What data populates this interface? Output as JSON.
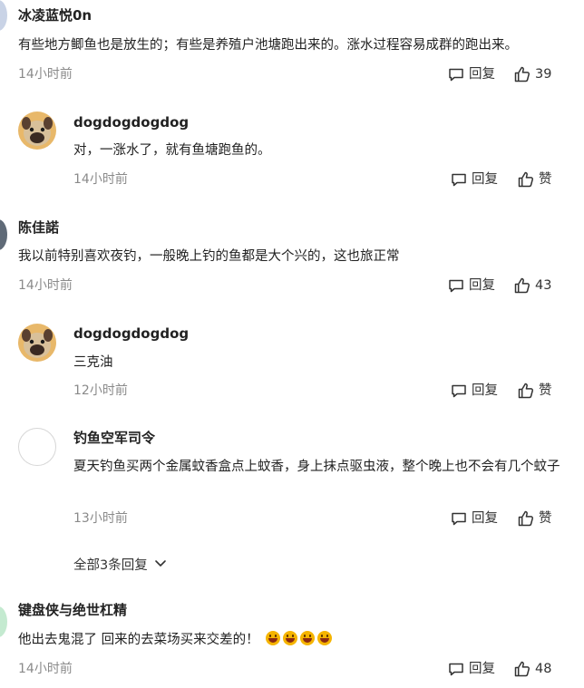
{
  "comments": [
    {
      "author": "冰凌蓝悦0n",
      "text": "有些地方鲫鱼也是放生的；有些是养殖户池塘跑出来的。涨水过程容易成群的跑出来。",
      "time": "14小时前",
      "reply_label": "回复",
      "likes": "39",
      "avatar_color": "#c9d3e6"
    },
    {
      "author": "dogdogdogdog",
      "text": "对，一涨水了，就有鱼塘跑鱼的。",
      "time": "14小时前",
      "reply_label": "回复",
      "likes": "赞",
      "avatar_icon": "pug-icon"
    },
    {
      "author": "陈佳諾",
      "text": "我以前特别喜欢夜钓，一般晚上钓的鱼都是大个兴的，这也旅正常",
      "time": "14小时前",
      "reply_label": "回复",
      "likes": "43",
      "avatar_color": "#5f6a77"
    },
    {
      "author": "dogdogdogdog",
      "text": "三克油",
      "time": "12小时前",
      "reply_label": "回复",
      "likes": "赞",
      "avatar_icon": "pug-icon"
    },
    {
      "author": "钓鱼空军司令",
      "text": "夏天钓鱼买两个金属蚊香盒点上蚊香，身上抹点驱虫液，整个晚上也不会有几个蚊子",
      "time": "13小时前",
      "reply_label": "回复",
      "likes": "赞",
      "avatar_color": "#ffffff"
    },
    {
      "author": "键盘侠与绝世杠精",
      "text": "他出去鬼混了 回来的去菜场买来交差的！",
      "emoji_count": 4,
      "emoji_icon": "grinning-face-icon",
      "time": "14小时前",
      "reply_label": "回复",
      "likes": "48",
      "avatar_color": "#c4ead0"
    }
  ],
  "expand_label": "全部3条回复"
}
